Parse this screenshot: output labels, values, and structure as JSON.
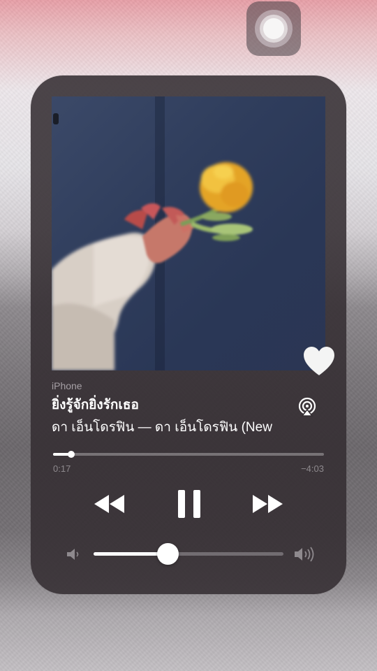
{
  "now_playing": {
    "source": "iPhone",
    "title": "ยิ่งรู้จักยิ่งรักเธอ",
    "artist_line": "ดา เอ็นโดรฟิน — ดา เอ็นโดรฟิน (New",
    "liked": true,
    "elapsed": "0:17",
    "remaining": "−4:03",
    "progress_fraction": 0.066,
    "volume_fraction": 0.39,
    "state": "playing"
  },
  "icons": {
    "assistive_touch": "assistive-touch-icon",
    "heart": "heart-icon",
    "airplay": "airplay-audio-icon",
    "rewind": "rewind-icon",
    "pause": "pause-icon",
    "forward": "fast-forward-icon",
    "volume_low": "speaker-low-icon",
    "volume_high": "speaker-high-icon"
  },
  "colors": {
    "card_background": "#342e32",
    "text_primary": "#ffffff",
    "text_secondary": "#a8a4a8",
    "accent": "#ffffff"
  }
}
